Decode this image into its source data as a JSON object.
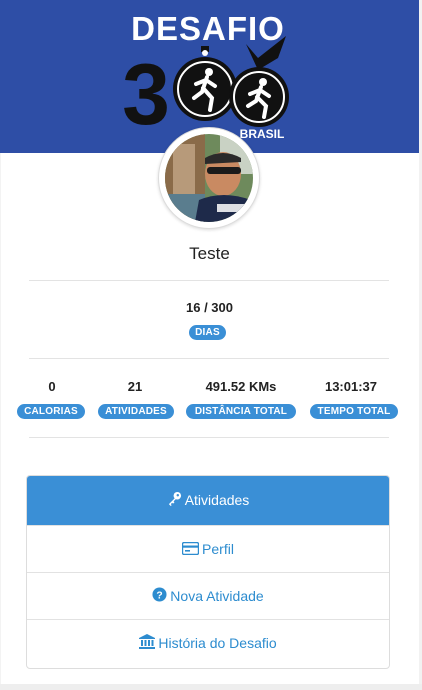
{
  "banner": {
    "logo_text": "DESAFIO 300",
    "logo_sub": "BRASIL",
    "color": "#2e4ea6"
  },
  "profile": {
    "name": "Teste",
    "avatar_icon": "user-photo"
  },
  "progress": {
    "count": "16 / 300",
    "badge": "DIAS",
    "done": 16,
    "total": 300
  },
  "stats": [
    {
      "value": "0",
      "label": "CALORIAS"
    },
    {
      "value": "21",
      "label": "ATIVIDADES"
    },
    {
      "value": "491.52 KMs",
      "label": "DISTÂNCIA TOTAL"
    },
    {
      "value": "13:01:37",
      "label": "TEMPO TOTAL"
    }
  ],
  "menu": [
    {
      "label": "Atividades",
      "icon": "key-icon",
      "active": true
    },
    {
      "label": "Perfil",
      "icon": "card-icon",
      "active": false
    },
    {
      "label": "Nova Atividade",
      "icon": "question-circle-icon",
      "active": false
    },
    {
      "label": "História do Desafio",
      "icon": "bank-icon",
      "active": false
    }
  ],
  "colors": {
    "accent": "#3a8fd6",
    "link": "#2d8ccf"
  }
}
